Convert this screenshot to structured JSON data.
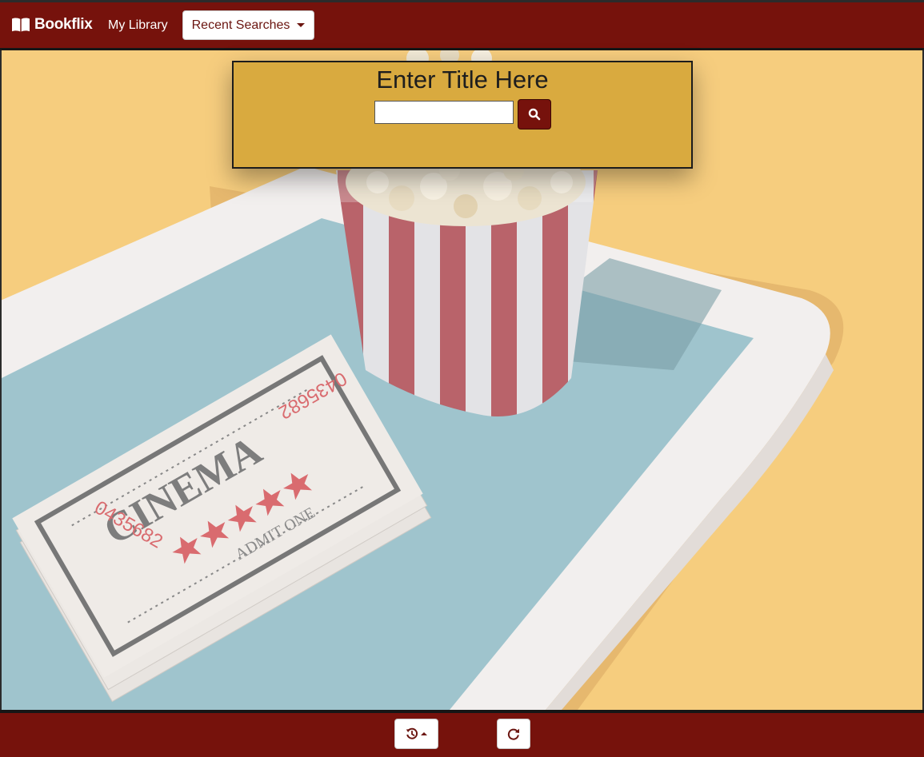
{
  "navbar": {
    "brand": "Bookflix",
    "brand_icon": "book-open-icon",
    "my_library": "My Library",
    "recent_searches": "Recent Searches"
  },
  "search": {
    "title": "Enter Title Here",
    "value": "",
    "placeholder": "",
    "button_icon": "search-icon"
  },
  "hero": {
    "ticket_word": "CINEMA",
    "ticket_admit": "ADMIT ONE",
    "ticket_number": "0435682"
  },
  "bottom_bar": {
    "history_icon": "history-icon",
    "reload_icon": "redo-icon"
  },
  "colors": {
    "brand": "#76120c",
    "panel": "#d9aa3f",
    "background": "#f6cd7e"
  }
}
